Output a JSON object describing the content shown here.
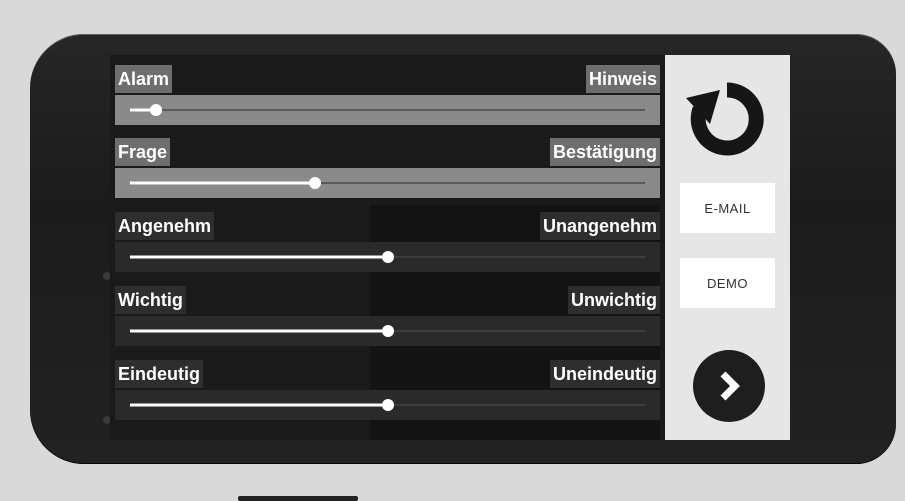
{
  "sliders": [
    {
      "left": "Alarm",
      "right": "Hinweis",
      "value": 0.05,
      "style": "light"
    },
    {
      "left": "Frage",
      "right": "Bestätigung",
      "value": 0.36,
      "style": "light"
    },
    {
      "left": "Angenehm",
      "right": "Unangenehm",
      "value": 0.5,
      "style": "dark"
    },
    {
      "left": "Wichtig",
      "right": "Unwichtig",
      "value": 0.5,
      "style": "dark"
    },
    {
      "left": "Eindeutig",
      "right": "Uneindeutig",
      "value": 0.5,
      "style": "dark"
    }
  ],
  "panel": {
    "reset_icon": "reset-icon",
    "email_label": "E-MAIL",
    "demo_label": "DEMO",
    "next_icon": "chevron-right-icon"
  }
}
